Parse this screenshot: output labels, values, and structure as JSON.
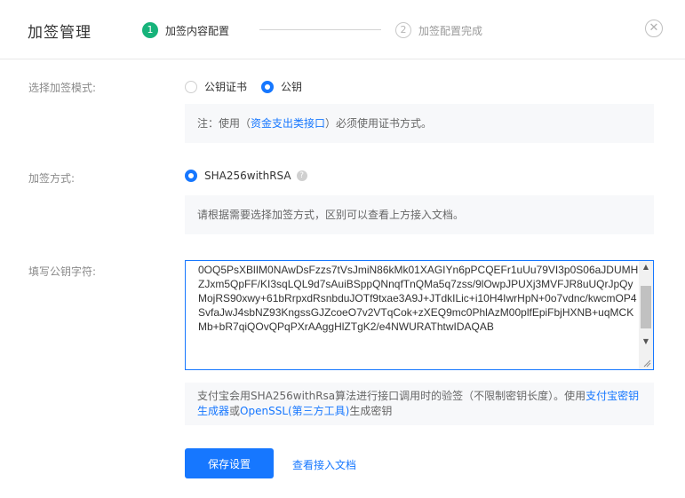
{
  "header": {
    "title": "加签管理",
    "step1": {
      "number": "1",
      "label": "加签内容配置"
    },
    "step2": {
      "number": "2",
      "label": "加签配置完成"
    },
    "close_icon": "close-icon"
  },
  "sign_mode": {
    "label": "选择加签模式:",
    "options": [
      {
        "label": "公钥证书",
        "selected": false
      },
      {
        "label": "公钥",
        "selected": true
      }
    ],
    "note_prefix": "注：使用（",
    "note_link": "资金支出类接口",
    "note_suffix": "）必须使用证书方式。"
  },
  "sign_method": {
    "label": "加签方式:",
    "option": "SHA256withRSA",
    "selected": true,
    "help_icon": "question-circle-icon",
    "note": "请根据需要选择加签方式，区别可以查看上方接入文档。"
  },
  "public_key": {
    "label": "填写公钥字符:",
    "value": "0OQ5PsXBlIM0NAwDsFzzs7tVsJmiN86kMk01XAGIYn6pPCQEFr1uUu79VI3p0S06aJDUMHZJxm5QpFF/KI3sqLQL9d7sAuiBSppQNnqfTnQMa5q7zss/9lOwpJPUXj3MVFJR8uUQrJpQyMojRS90xwy+61bRrpxdRsnbduJOTf9txae3A9J+JTdkILic+i10H4IwrHpN+0o7vdnc/kwcmOP4SvfaJwJ4sbNZ93KngssGJZcoeO7v2VTqCok+zXEQ9mc0PhlAzM00plfEpiFbjHXNB+uqMCKMb+bR7qiQOvQPqPXrAAggHlZTgK2/e4NWURAThtwIDAQAB",
    "note_prefix": "支付宝会用SHA256withRsa算法进行接口调用时的验签（不限制密钥长度）。使用",
    "note_link1": "支付宝密钥生成器",
    "note_mid": "或",
    "note_link2": "OpenSSL(第三方工具)",
    "note_suffix": "生成密钥"
  },
  "actions": {
    "save": "保存设置",
    "view_doc": "查看接入文档"
  },
  "colors": {
    "primary": "#1677ff",
    "step_active": "#16b37a",
    "note_bg": "#f7f8fa"
  }
}
